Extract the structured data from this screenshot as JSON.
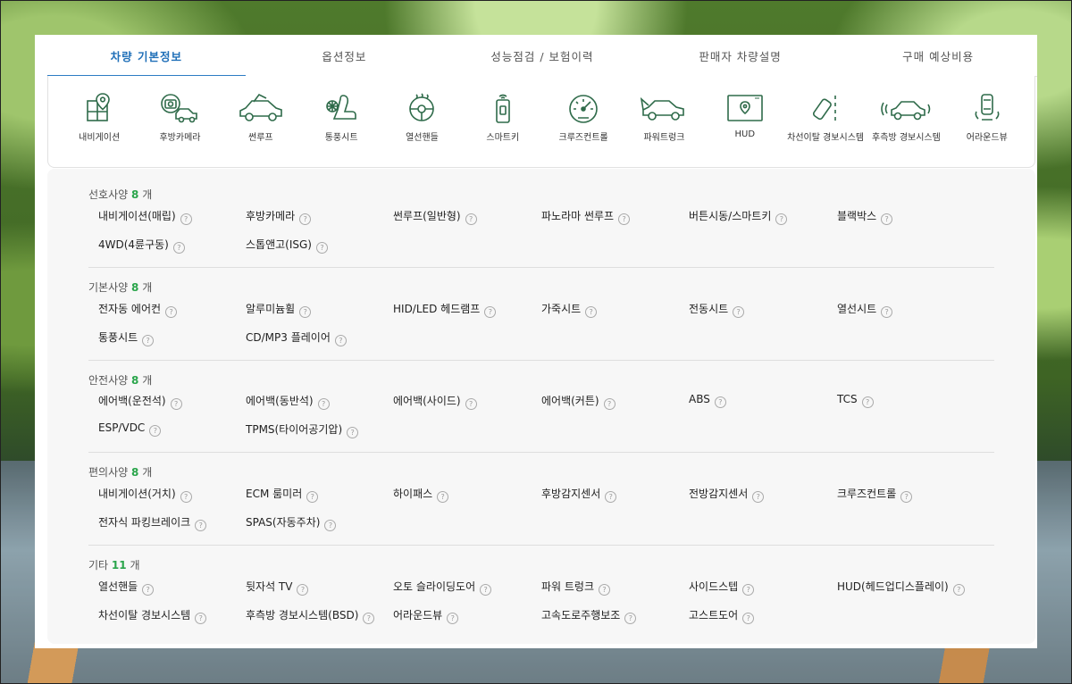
{
  "tabs": [
    "차량 기본정보",
    "옵션정보",
    "성능점검 / 보험이력",
    "판매자 차량설명",
    "구매 예상비용"
  ],
  "icons": [
    {
      "label": "내비게이션",
      "icon": "navigation-icon"
    },
    {
      "label": "후방카메라",
      "icon": "rear-camera-icon"
    },
    {
      "label": "썬루프",
      "icon": "sunroof-icon"
    },
    {
      "label": "통풍시트",
      "icon": "ventilated-seat-icon"
    },
    {
      "label": "열선핸들",
      "icon": "heated-steering-icon"
    },
    {
      "label": "스마트키",
      "icon": "smart-key-icon"
    },
    {
      "label": "크루즈컨트롤",
      "icon": "cruise-control-icon"
    },
    {
      "label": "파워트렁크",
      "icon": "power-trunk-icon"
    },
    {
      "label": "HUD",
      "icon": "hud-icon"
    },
    {
      "label": "차선이탈 경보시스템",
      "icon": "lane-departure-icon"
    },
    {
      "label": "후측방 경보시스템",
      "icon": "blind-spot-icon"
    },
    {
      "label": "어라운드뷰",
      "icon": "around-view-icon"
    }
  ],
  "groups": [
    {
      "title": "선호사양",
      "count": "8",
      "unit": "개",
      "items": [
        "내비게이션(매립)",
        "후방카메라",
        "썬루프(일반형)",
        "파노라마 썬루프",
        "버튼시동/스마트키",
        "블랙박스",
        "4WD(4륜구동)",
        "스톱앤고(ISG)"
      ]
    },
    {
      "title": "기본사양",
      "count": "8",
      "unit": "개",
      "items": [
        "전자동 에어컨",
        "알루미늄휠",
        "HID/LED 헤드램프",
        "가죽시트",
        "전동시트",
        "열선시트",
        "통풍시트",
        "CD/MP3 플레이어"
      ]
    },
    {
      "title": "안전사양",
      "count": "8",
      "unit": "개",
      "items": [
        "에어백(운전석)",
        "에어백(동반석)",
        "에어백(사이드)",
        "에어백(커튼)",
        "ABS",
        "TCS",
        "ESP/VDC",
        "TPMS(타이어공기압)"
      ]
    },
    {
      "title": "편의사양",
      "count": "8",
      "unit": "개",
      "items": [
        "내비게이션(거치)",
        "ECM 룸미러",
        "하이패스",
        "후방감지센서",
        "전방감지센서",
        "크루즈컨트롤",
        "전자식 파킹브레이크",
        "SPAS(자동주차)"
      ]
    },
    {
      "title": "기타",
      "count": "11",
      "unit": "개",
      "items": [
        "열선핸들",
        "뒷자석 TV",
        "오토 슬라이딩도어",
        "파워 트렁크",
        "사이드스텝",
        "HUD(헤드업디스플레이)",
        "차선이탈 경보시스템",
        "후측방 경보시스템(BSD)",
        "어라운드뷰",
        "고속도로주행보조",
        "고스트도어"
      ]
    }
  ],
  "help_glyph": "?",
  "colors": {
    "active_tab": "#1f6fb8",
    "count": "#2aa54b",
    "icon": "#2f6b4a"
  }
}
